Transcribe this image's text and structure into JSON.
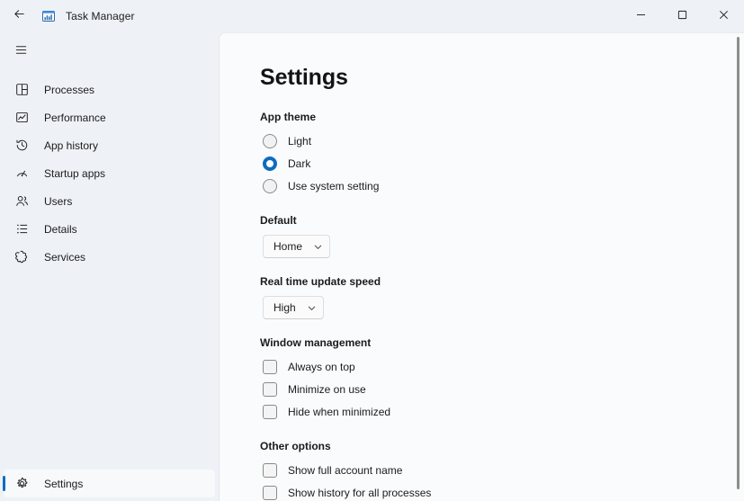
{
  "titlebar": {
    "back_icon": "back-arrow-icon",
    "app_icon": "task-manager-icon",
    "title": "Task Manager",
    "minimize_icon": "minimize-icon",
    "maximize_icon": "maximize-icon",
    "close_icon": "close-icon"
  },
  "sidebar": {
    "menu_icon": "hamburger-menu-icon",
    "items": [
      {
        "label": "Processes",
        "icon": "processes-icon",
        "selected": false
      },
      {
        "label": "Performance",
        "icon": "performance-icon",
        "selected": false
      },
      {
        "label": "App history",
        "icon": "app-history-icon",
        "selected": false
      },
      {
        "label": "Startup apps",
        "icon": "startup-apps-icon",
        "selected": false
      },
      {
        "label": "Users",
        "icon": "users-icon",
        "selected": false
      },
      {
        "label": "Details",
        "icon": "details-icon",
        "selected": false
      },
      {
        "label": "Services",
        "icon": "services-icon",
        "selected": false
      }
    ],
    "footer": {
      "label": "Settings",
      "icon": "gear-icon",
      "selected": true
    }
  },
  "main": {
    "title": "Settings",
    "app_theme": {
      "heading": "App theme",
      "options": [
        {
          "label": "Light",
          "checked": false
        },
        {
          "label": "Dark",
          "checked": true
        },
        {
          "label": "Use system setting",
          "checked": false
        }
      ]
    },
    "default": {
      "heading": "Default",
      "value": "Home",
      "chevron_icon": "chevron-down-icon"
    },
    "update_speed": {
      "heading": "Real time update speed",
      "value": "High",
      "chevron_icon": "chevron-down-icon"
    },
    "window_management": {
      "heading": "Window management",
      "options": [
        {
          "label": "Always on top",
          "checked": false
        },
        {
          "label": "Minimize on use",
          "checked": false
        },
        {
          "label": "Hide when minimized",
          "checked": false
        }
      ]
    },
    "other_options": {
      "heading": "Other options",
      "options": [
        {
          "label": "Show full account name",
          "checked": false
        },
        {
          "label": "Show history for all processes",
          "checked": false
        }
      ]
    }
  },
  "colors": {
    "accent": "#0f6cbd",
    "sidebar_bg": "#eef2f7",
    "content_bg": "#fafbfc",
    "text": "#1b1b1b"
  }
}
